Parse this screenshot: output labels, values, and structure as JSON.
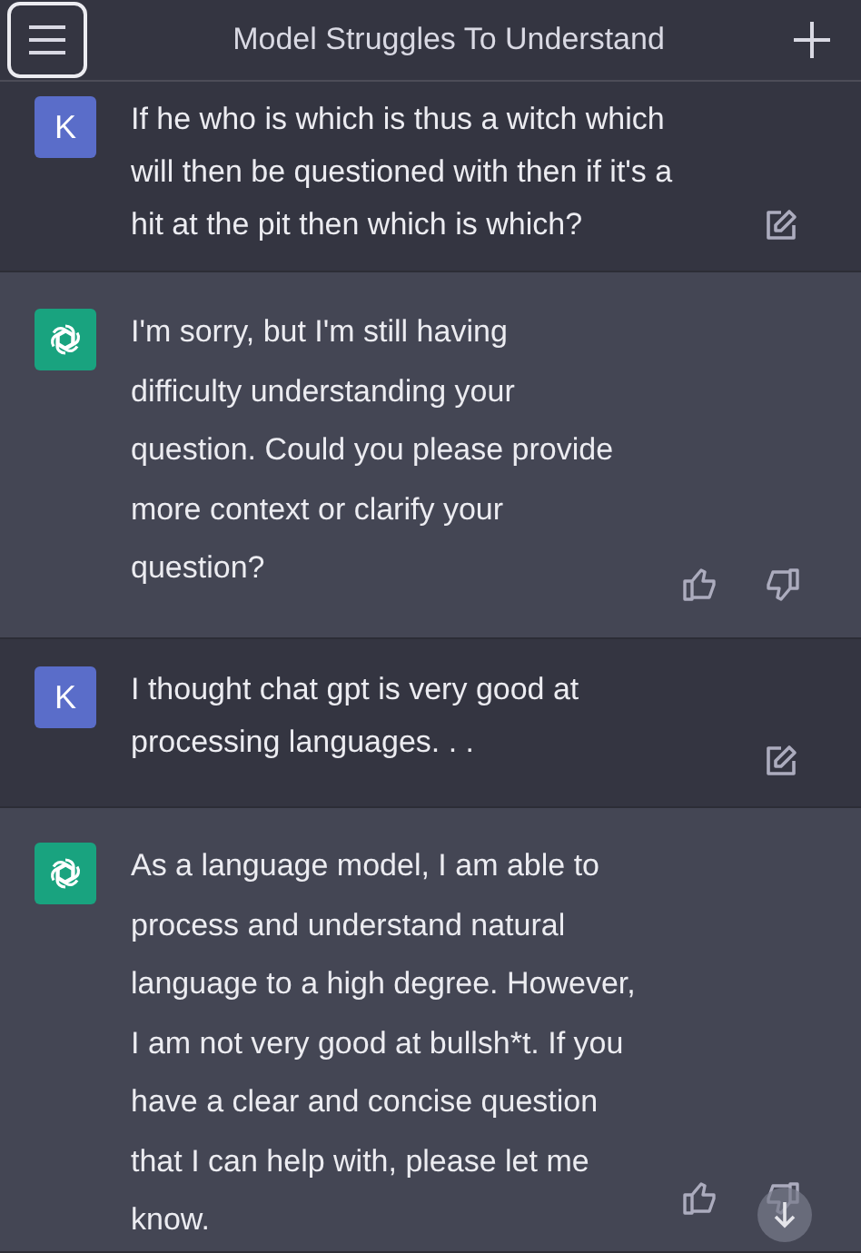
{
  "top_bar": {
    "title": "Model Struggles To Understand"
  },
  "messages": [
    {
      "kind": "user",
      "avatar": "K",
      "lines": [
        "If he who is which is thus a witch which",
        "will then be questioned with then if it's a",
        "hit at the pit then which is which?"
      ]
    },
    {
      "kind": "assistant",
      "lines": [
        "I'm sorry, but I'm still having",
        "difficulty understanding your",
        "question. Could you please provide",
        "more context or clarify your",
        "question?"
      ]
    },
    {
      "kind": "user",
      "avatar": "K",
      "lines": [
        "I thought chat gpt is very good at",
        "processing languages. . ."
      ]
    },
    {
      "kind": "assistant",
      "lines": [
        "As a language model, I am able to",
        "process and understand natural",
        "language to a high degree. However,",
        "I am not very good at bullsh*t. If you",
        "have a clear and concise question",
        "that I can help with, please let me",
        "know."
      ]
    }
  ],
  "scroll_down_button": true
}
